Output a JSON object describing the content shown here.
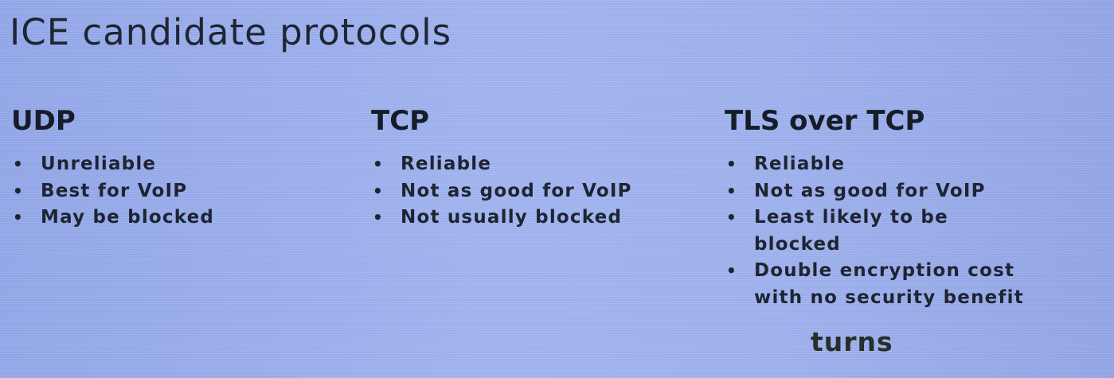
{
  "slide": {
    "title": "ICE candidate protocols",
    "columns": [
      {
        "heading": "UDP",
        "bullets": [
          "Unreliable",
          "Best for VoIP",
          "May be blocked"
        ]
      },
      {
        "heading": "TCP",
        "bullets": [
          "Reliable",
          "Not as good for VoIP",
          "Not usually blocked"
        ]
      },
      {
        "heading": "TLS over TCP",
        "bullets": [
          "Reliable",
          "Not as good for VoIP",
          "Least likely to be blocked",
          "Double encryption cost with no security benefit"
        ]
      }
    ],
    "footer_note": "turns",
    "bullet_glyph": "•"
  }
}
